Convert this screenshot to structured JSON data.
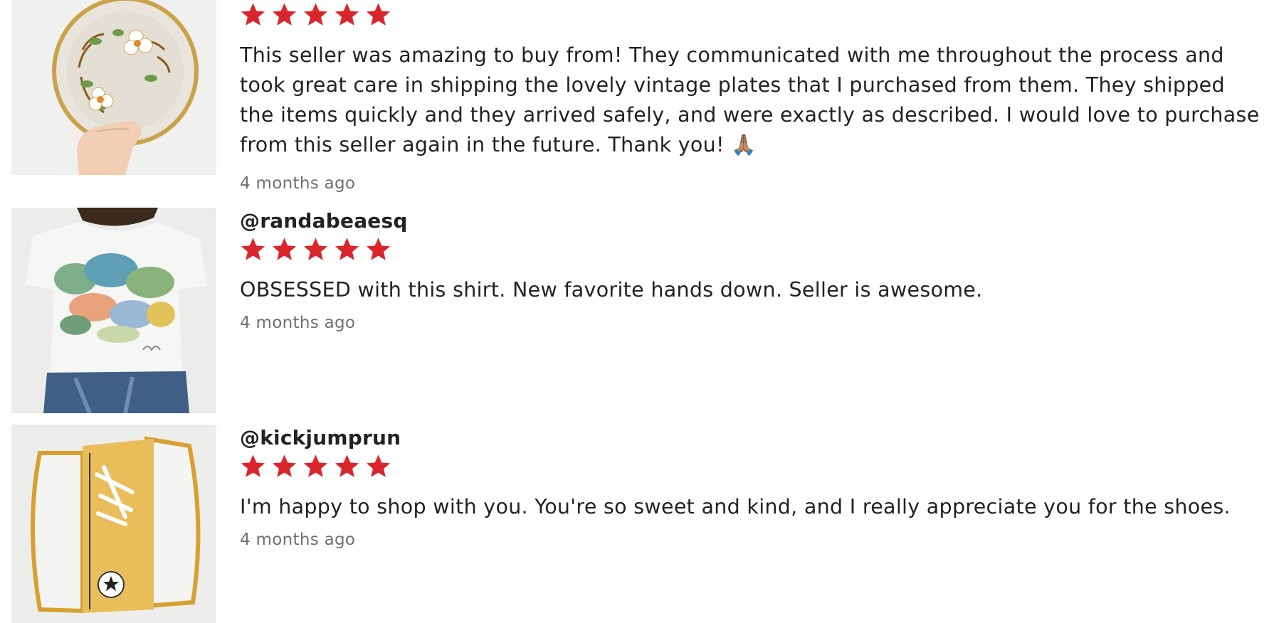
{
  "colors": {
    "star": "#d9262c",
    "time": "#707070",
    "text": "#222222"
  },
  "reviews": [
    {
      "username": "",
      "rating": 5,
      "thumbnail_icon": "vintage-floral-plate-photo",
      "text": "This seller was amazing to buy from! They communicated with me throughout the process and took great care in shipping the lovely vintage plates that I purchased from them. They shipped the items quickly and they arrived safely, and were exactly as described. I would love to purchase from this seller again in the future. Thank you! 🙏🏽",
      "time": "4 months ago"
    },
    {
      "username": "@randabeaesq",
      "rating": 5,
      "thumbnail_icon": "painted-landscape-shirt-photo",
      "text": "OBSESSED with this shirt. New favorite hands down. Seller is awesome.",
      "time": "4 months ago"
    },
    {
      "username": "@kickjumprun",
      "rating": 5,
      "thumbnail_icon": "yellow-platform-sneaker-photo",
      "text": "I'm happy to shop with you. You're so sweet and kind, and I really appreciate you for the shoes.",
      "time": "4 months ago"
    }
  ]
}
